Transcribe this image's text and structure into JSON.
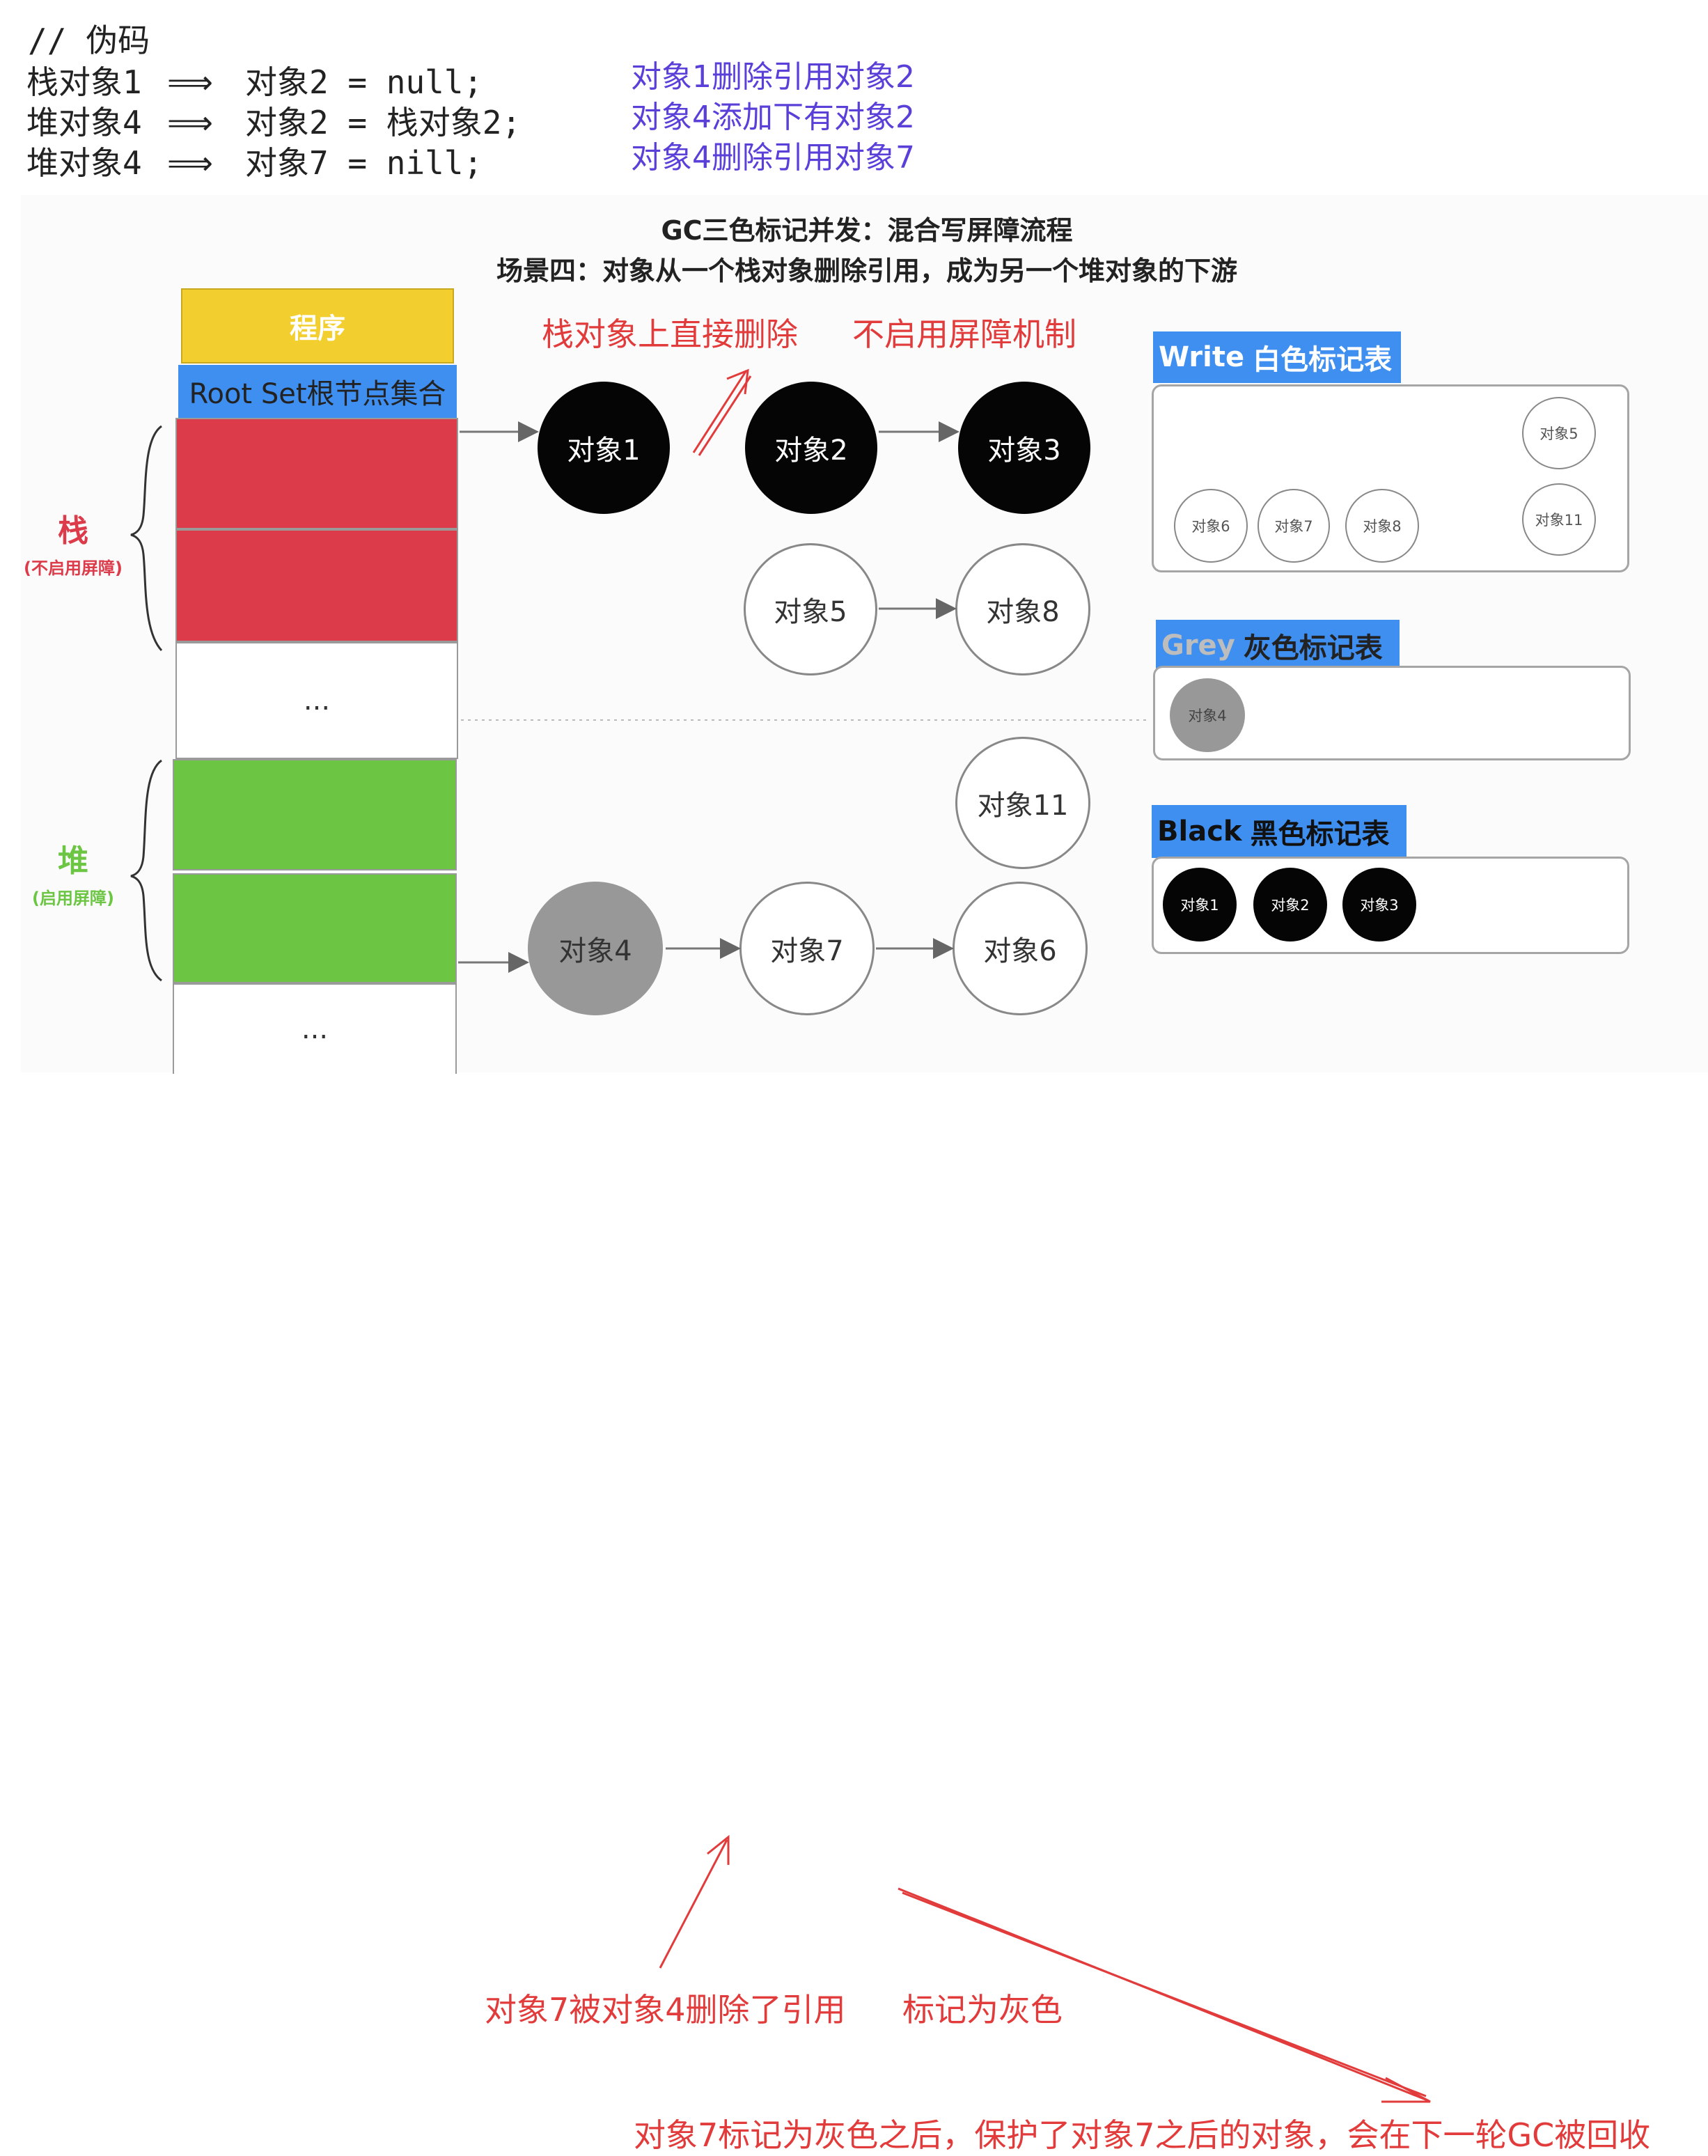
{
  "code": {
    "comment": "// 伪码",
    "lines": [
      {
        "left": "栈对象1",
        "arrow": "⟹",
        "right": "对象2 = null;",
        "note": "对象1删除引用对象2"
      },
      {
        "left": "堆对象4",
        "arrow": "⟹",
        "right": "对象2 = 栈对象2;",
        "note": "对象4添加下有对象2"
      },
      {
        "left": "堆对象4",
        "arrow": "⟹",
        "right": "对象7 = nill;",
        "note": "对象4删除引用对象7"
      }
    ]
  },
  "diagram": {
    "title": "GC三色标记并发：混合写屏障流程",
    "subtitle": "场景四：对象从一个栈对象删除引用，成为另一个堆对象的下游",
    "program": "程序",
    "root_set": "Root Set根节点集合",
    "ellipsis": "...",
    "stack": {
      "label": "栈",
      "sub": "(不启用屏障)"
    },
    "heap": {
      "label": "堆",
      "sub": "(启用屏障)"
    },
    "nodes": {
      "obj1": "对象1",
      "obj2": "对象2",
      "obj3": "对象3",
      "obj5": "对象5",
      "obj8": "对象8",
      "obj11": "对象11",
      "obj4": "对象4",
      "obj7": "对象7",
      "obj6": "对象6"
    },
    "tables": {
      "white": {
        "tag_en": "Write",
        "tag_cn": "白色标记表",
        "items": [
          "对象5",
          "对象6",
          "对象7",
          "对象8",
          "对象11"
        ]
      },
      "grey": {
        "tag_en": "Grey",
        "tag_cn": "灰色标记表",
        "items": [
          "对象4"
        ]
      },
      "black": {
        "tag_en": "Black",
        "tag_cn": "黑色标记表",
        "items": [
          "对象1",
          "对象2",
          "对象3"
        ]
      }
    }
  },
  "annotations": {
    "stack_delete": "栈对象上直接删除",
    "no_barrier": "不启用屏障机制",
    "obj7_removed": "对象7被对象4删除了引用",
    "mark_grey": "标记为灰色",
    "conclusion": "对象7标记为灰色之后，保护了对象7之后的对象，会在下一轮GC被回收"
  },
  "colors": {
    "note_purple": "#5b3fd9",
    "annotation_red": "#e23b3b",
    "stack_red": "#dc3b4a",
    "heap_green": "#6cc644",
    "program_yellow": "#f2cf2e",
    "tag_blue": "#3f8ff0"
  }
}
